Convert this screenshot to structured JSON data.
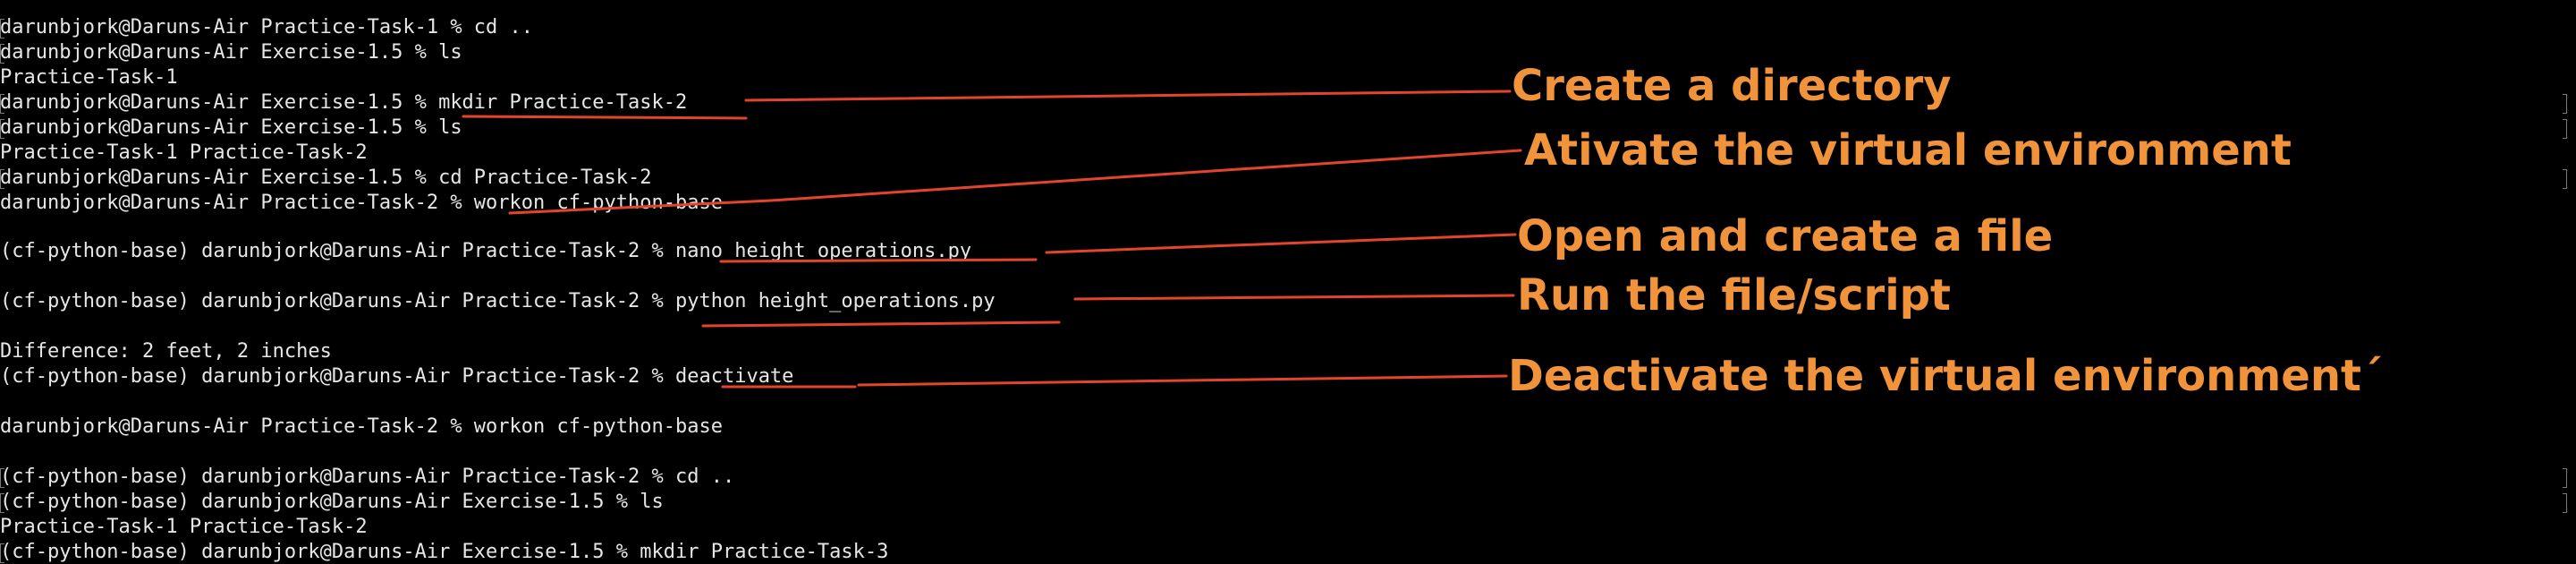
{
  "terminal": {
    "lines": [
      "darunbjork@Daruns-Air Practice-Task-1 % cd ..",
      "darunbjork@Daruns-Air Exercise-1.5 % ls",
      "Practice-Task-1",
      "darunbjork@Daruns-Air Exercise-1.5 % mkdir Practice-Task-2",
      "darunbjork@Daruns-Air Exercise-1.5 % ls",
      "Practice-Task-1 Practice-Task-2",
      "darunbjork@Daruns-Air Exercise-1.5 % cd Practice-Task-2",
      "darunbjork@Daruns-Air Practice-Task-2 % workon cf-python-base",
      "(cf-python-base) darunbjork@Daruns-Air Practice-Task-2 % nano height_operations.py",
      "(cf-python-base) darunbjork@Daruns-Air Practice-Task-2 % python height_operations.py",
      "Difference: 2 feet, 2 inches",
      "(cf-python-base) darunbjork@Daruns-Air Practice-Task-2 % deactivate",
      "darunbjork@Daruns-Air Practice-Task-2 % workon cf-python-base",
      "(cf-python-base) darunbjork@Daruns-Air Practice-Task-2 % cd ..",
      "(cf-python-base) darunbjork@Daruns-Air Exercise-1.5 % ls",
      "Practice-Task-1 Practice-Task-2",
      "(cf-python-base) darunbjork@Daruns-Air Exercise-1.5 % mkdir Practice-Task-3"
    ]
  },
  "annotations": {
    "create_directory": "Create a directory",
    "activate_env": "Ativate the virtual environment",
    "open_file": "Open and create a file",
    "run_file": "Run the file/script",
    "deactivate_env": "Deactivate the virtual environment´"
  },
  "colors": {
    "background": "#000000",
    "terminal_text": "#e6e6e6",
    "annotation_text": "#f0933a",
    "annotation_line": "#e2452c"
  }
}
